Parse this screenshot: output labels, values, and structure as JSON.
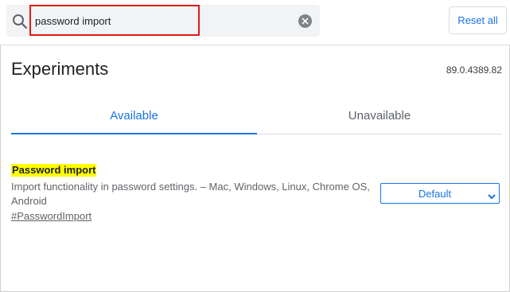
{
  "search": {
    "value": "password import",
    "icon": "search-icon",
    "clear_icon": "close-icon"
  },
  "header": {
    "reset_label": "Reset all"
  },
  "page": {
    "title": "Experiments",
    "version": "89.0.4389.82"
  },
  "tabs": [
    {
      "label": "Available",
      "active": true
    },
    {
      "label": "Unavailable",
      "active": false
    }
  ],
  "experiment": {
    "title": "Password import",
    "description": "Import functionality in password settings. – Mac, Windows, Linux, Chrome OS, Android",
    "link": "#PasswordImport",
    "selected_option": "Default"
  },
  "colors": {
    "accent": "#1a73e8",
    "highlight": "#ffff00",
    "annotation_box": "#e11b1b"
  }
}
